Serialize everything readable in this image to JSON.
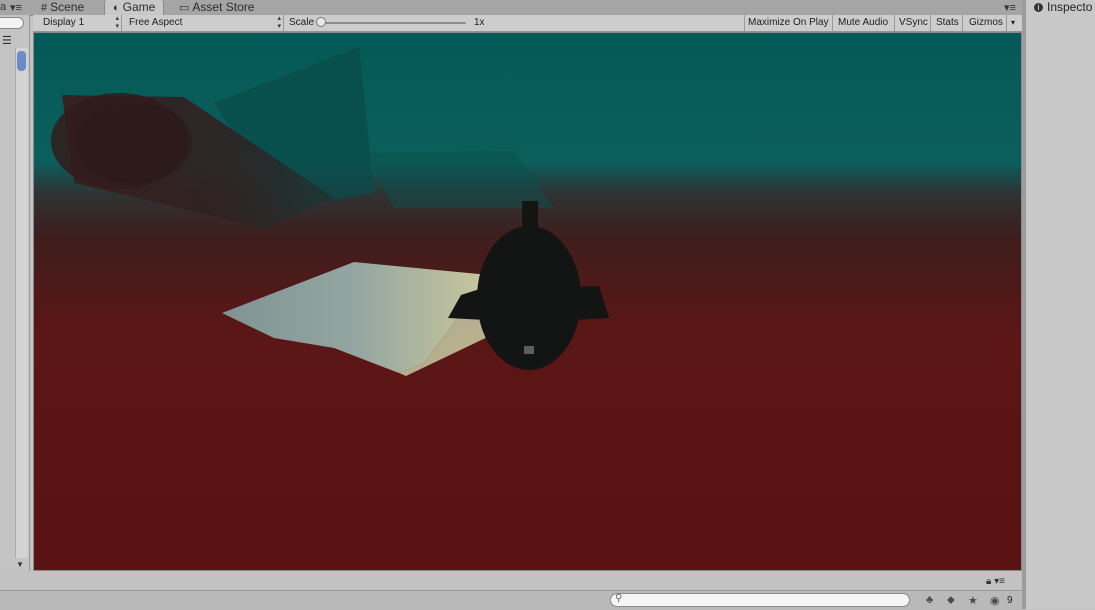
{
  "tabs": [
    {
      "label": "Scene",
      "icon": "grid-icon"
    },
    {
      "label": "Game",
      "icon": "pacman-icon"
    },
    {
      "label": "Asset Store",
      "icon": "store-icon"
    }
  ],
  "toolbar": {
    "display": "Display 1",
    "aspect": "Free Aspect",
    "scale_label": "Scale",
    "scale_value": "1x",
    "maximize_on_play": "Maximize On Play",
    "mute_audio": "Mute Audio",
    "vsync": "VSync",
    "stats": "Stats",
    "gizmos": "Gizmos"
  },
  "inspector": {
    "tab_label": "Inspecto"
  },
  "bottom": {
    "hidden_count": "9"
  },
  "colors": {
    "sky": "#07605c",
    "ground": "#5a1313",
    "slab": "#9fb0a8",
    "player": "#141414"
  }
}
